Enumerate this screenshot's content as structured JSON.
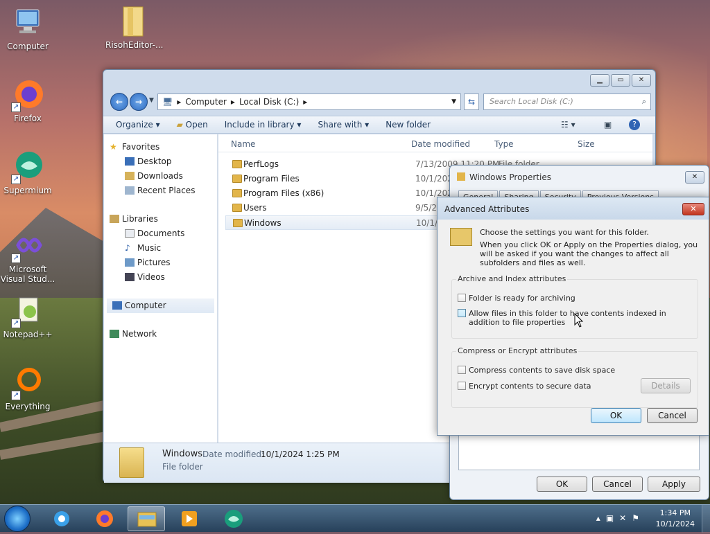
{
  "desktop": {
    "icons": [
      {
        "label": "Computer",
        "icon": "computer-icon"
      },
      {
        "label": "RisohEditor-...",
        "icon": "folder-icon"
      },
      {
        "label": "Firefox",
        "icon": "firefox-icon"
      },
      {
        "label": "Supermium",
        "icon": "supermium-icon"
      },
      {
        "label": "Microsoft Visual Stud...",
        "icon": "visual-studio-icon"
      },
      {
        "label": "Notepad++",
        "icon": "notepadpp-icon"
      },
      {
        "label": "Everything",
        "icon": "everything-icon"
      }
    ]
  },
  "explorer": {
    "breadcrumb": [
      "Computer",
      "Local Disk (C:)"
    ],
    "search_placeholder": "Search Local Disk (C:)",
    "toolbar": {
      "organize": "Organize",
      "open": "Open",
      "include": "Include in library",
      "share": "Share with",
      "new_folder": "New folder"
    },
    "nav": {
      "favorites": "Favorites",
      "desktop": "Desktop",
      "downloads": "Downloads",
      "recent": "Recent Places",
      "libraries": "Libraries",
      "documents": "Documents",
      "music": "Music",
      "pictures": "Pictures",
      "videos": "Videos",
      "computer": "Computer",
      "network": "Network"
    },
    "columns": {
      "name": "Name",
      "date": "Date modified",
      "type": "Type",
      "size": "Size"
    },
    "files": [
      {
        "name": "PerfLogs",
        "date": "7/13/2009 11:20 PM",
        "type": "File folder"
      },
      {
        "name": "Program Files",
        "date": "10/1/2024"
      },
      {
        "name": "Program Files (x86)",
        "date": "10/1/2024"
      },
      {
        "name": "Users",
        "date": "9/5/2024"
      },
      {
        "name": "Windows",
        "date": "10/1/2024"
      }
    ],
    "details": {
      "name": "Windows",
      "date_label": "Date modified:",
      "date_value": "10/1/2024 1:25 PM",
      "type": "File folder"
    }
  },
  "properties": {
    "title": "Windows Properties",
    "tabs": [
      "General",
      "Sharing",
      "Security",
      "Previous Versions"
    ],
    "ok": "OK",
    "cancel": "Cancel",
    "apply": "Apply"
  },
  "advanced": {
    "title": "Advanced Attributes",
    "intro": "Choose the settings you want for this folder.",
    "intro2": "When you click OK or Apply on the Properties dialog, you will be asked if you want the changes to affect all subfolders and files as well.",
    "group1": "Archive and Index attributes",
    "archive": "Folder is ready for archiving",
    "index": "Allow files in this folder to have contents indexed in addition to file properties",
    "group2": "Compress or Encrypt attributes",
    "compress": "Compress contents to save disk space",
    "encrypt": "Encrypt contents to secure data",
    "details": "Details",
    "ok": "OK",
    "cancel": "Cancel"
  },
  "taskbar": {
    "time": "1:34 PM",
    "date": "10/1/2024"
  }
}
